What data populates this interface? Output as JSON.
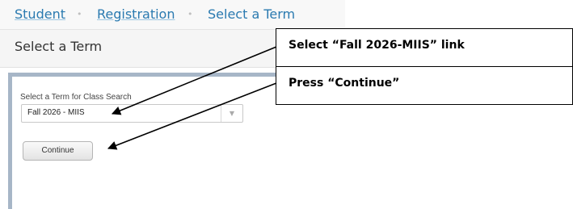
{
  "breadcrumb": {
    "items": [
      "Student",
      "Registration",
      "Select a Term"
    ],
    "separator": "•"
  },
  "page": {
    "title": "Select a Term"
  },
  "form": {
    "term_label": "Select a Term for Class Search",
    "term_select": {
      "value": "Fall 2026 - MIIS",
      "arrow_icon": "▼"
    },
    "continue_label": "Continue"
  },
  "callouts": [
    "Select “Fall 2026-MIIS” link",
    "Press “Continue”"
  ],
  "colors": {
    "link": "#2a7ab0",
    "panel_border": "#a7b6c7"
  }
}
